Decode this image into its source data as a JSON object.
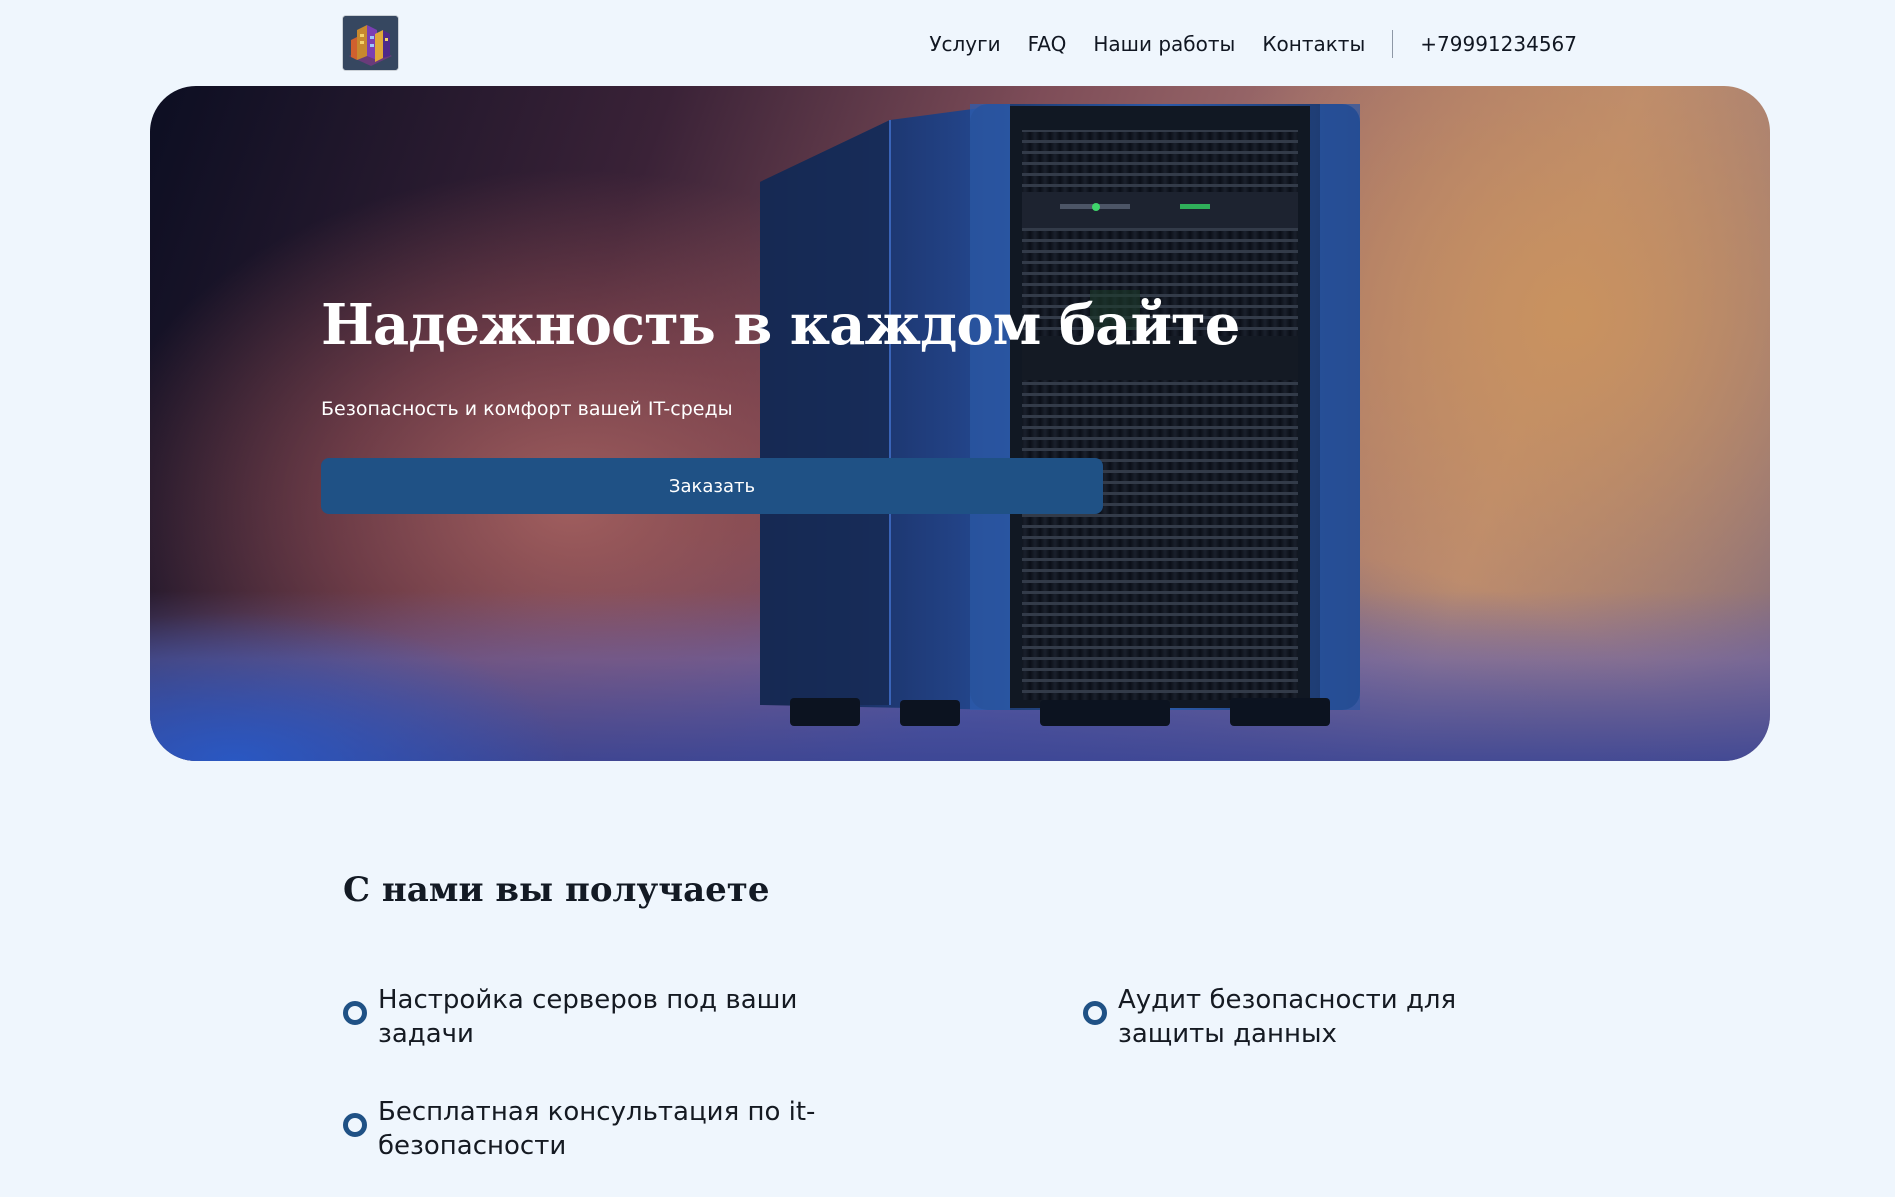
{
  "header": {
    "logo_icon": "isometric-server-logo",
    "nav": {
      "services": "Услуги",
      "faq": "FAQ",
      "works": "Наши работы",
      "contacts": "Контакты"
    },
    "phone": "+79991234567"
  },
  "hero": {
    "title": "Надежность в каждом байте",
    "subtitle": "Безопасность и комфорт вашей IT-среды",
    "cta_label": "Заказать"
  },
  "benefits": {
    "title": "С нами вы получаете",
    "items": [
      "Настройка серверов под ваши задачи",
      "Аудит безопасности для защиты данных",
      "Бесплатная консультация по it-безопасности"
    ]
  },
  "colors": {
    "background": "#eff6fd",
    "accent": "#1f5185",
    "text": "#151a22"
  }
}
